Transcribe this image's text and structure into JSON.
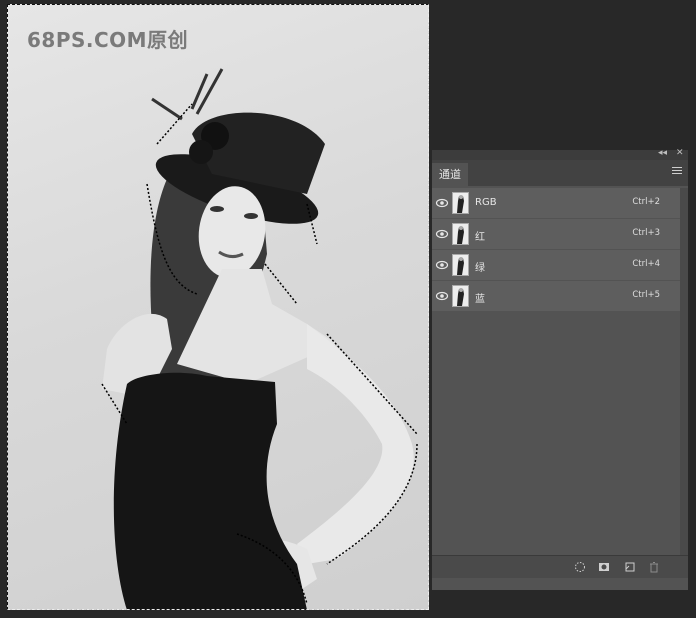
{
  "watermark": "68PS.COM原创",
  "panel": {
    "tab_label": "通道",
    "collapse_label": "◂◂",
    "close_label": "✕",
    "channels": [
      {
        "name": "RGB",
        "shortcut": "Ctrl+2"
      },
      {
        "name": "红",
        "shortcut": "Ctrl+3"
      },
      {
        "name": "绿",
        "shortcut": "Ctrl+4"
      },
      {
        "name": "蓝",
        "shortcut": "Ctrl+5"
      }
    ],
    "footer_buttons": [
      "load-selection-icon",
      "save-selection-icon",
      "new-channel-icon",
      "trash-icon"
    ]
  },
  "colors": {
    "workspace_bg": "#282828",
    "panel_bg": "#535353",
    "row_bg": "#5e5e5e",
    "text": "#e6e6e6"
  }
}
